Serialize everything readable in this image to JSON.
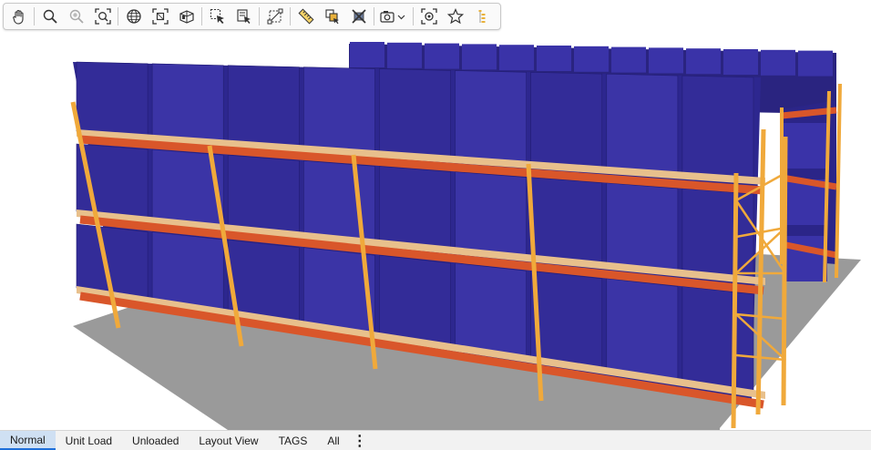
{
  "toolbar": {
    "icons": [
      "pan-hand-icon",
      "zoom-icon",
      "zoom-disabled-icon",
      "zoom-extents-icon",
      "globe-view-icon",
      "fit-selection-icon",
      "camera-view-icon",
      "select-arrow-icon",
      "select-document-icon",
      "transform-icon",
      "measure-ruler-icon",
      "copy-layers-icon",
      "delete-crossed-icon",
      "camera-snapshot-icon",
      "focus-target-icon",
      "favorite-star-icon",
      "tree-list-icon"
    ]
  },
  "scene": {
    "rack_upright_color": "#f0a93b",
    "beam_color": "#d9562a",
    "pallet_color": "#e8c08c",
    "box_color": "#332c98",
    "floor_color": "#9a9a9a"
  },
  "tabs": [
    {
      "label": "Normal",
      "active": true
    },
    {
      "label": "Unit Load",
      "active": false
    },
    {
      "label": "Unloaded",
      "active": false
    },
    {
      "label": "Layout View",
      "active": false
    },
    {
      "label": "TAGS",
      "active": false
    },
    {
      "label": "All",
      "active": false
    }
  ],
  "more_label": "⋮"
}
